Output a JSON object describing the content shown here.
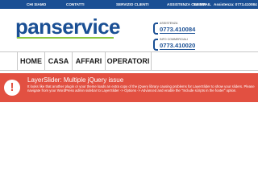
{
  "top_nav": {
    "links": [
      "CHI SIAMO",
      "CONTATTI",
      "SERVIZIO CLIENTI",
      "ASSISTENZA CLIENTI",
      "WEBMAIL"
    ],
    "assistance_text": "Assistenza: 0773.410084"
  },
  "brand": {
    "logo_text": "panservice"
  },
  "contacts": [
    {
      "label": "ASSISTENZA",
      "number": "0773.410084"
    },
    {
      "label": "INFO COMMERCIALI",
      "number": "0773.410020"
    }
  ],
  "main_menu": {
    "items": [
      "HOME",
      "CASA",
      "AFFARI",
      "OPERATORI"
    ]
  },
  "alert": {
    "icon_glyph": "!",
    "title": "LayerSlider: Multiple jQuery issue",
    "body": "It looks like that another plugin or your theme loads an extra copy of the jQuery library causing problems for LayerSlider to show your sliders. Please navigate from your WordPress admin sidebar to LayerSlider -> Options -> Advanced and enable the \"Include scripts in the footer\" option."
  },
  "colors": {
    "brand_blue": "#1a4f94",
    "accent_green": "#8cc63f",
    "alert_red": "#e25041"
  }
}
